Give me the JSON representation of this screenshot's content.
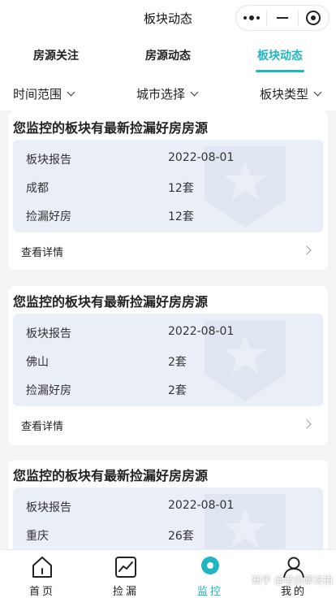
{
  "titlebar": {
    "title": "板块动态"
  },
  "tabs": [
    {
      "label": "房源关注"
    },
    {
      "label": "房源动态"
    },
    {
      "label": "板块动态"
    }
  ],
  "active_tab": "板块动态",
  "filters": [
    {
      "label": "时间范围"
    },
    {
      "label": "城市选择"
    },
    {
      "label": "板块类型"
    }
  ],
  "cards": [
    {
      "title": "您监控的板块有最新捡漏好房房源",
      "rows": [
        {
          "label": "板块报告",
          "value": "2022-08-01"
        },
        {
          "label": "成都",
          "value": "12套"
        },
        {
          "label": "捡漏好房",
          "value": "12套"
        }
      ],
      "detail": "查看详情"
    },
    {
      "title": "您监控的板块有最新捡漏好房房源",
      "rows": [
        {
          "label": "板块报告",
          "value": "2022-08-01"
        },
        {
          "label": "佛山",
          "value": "2套"
        },
        {
          "label": "捡漏好房",
          "value": "2套"
        }
      ],
      "detail": "查看详情"
    },
    {
      "title": "您监控的板块有最新捡漏好房房源",
      "rows": [
        {
          "label": "板块报告",
          "value": "2022-08-01"
        },
        {
          "label": "重庆",
          "value": "26套"
        }
      ]
    }
  ],
  "bottom_nav": [
    {
      "label": "首页",
      "icon": "home-icon"
    },
    {
      "label": "捡漏",
      "icon": "chart-icon"
    },
    {
      "label": "监控",
      "icon": "monitor-icon"
    },
    {
      "label": "我的",
      "icon": "user-icon"
    }
  ],
  "active_nav": "监控",
  "watermark_text": "知乎 @老白聊法拍",
  "colors": {
    "accent": "#1fb5c3",
    "info_bg": "#eaeef6",
    "page_bg": "#f3f4f6"
  }
}
